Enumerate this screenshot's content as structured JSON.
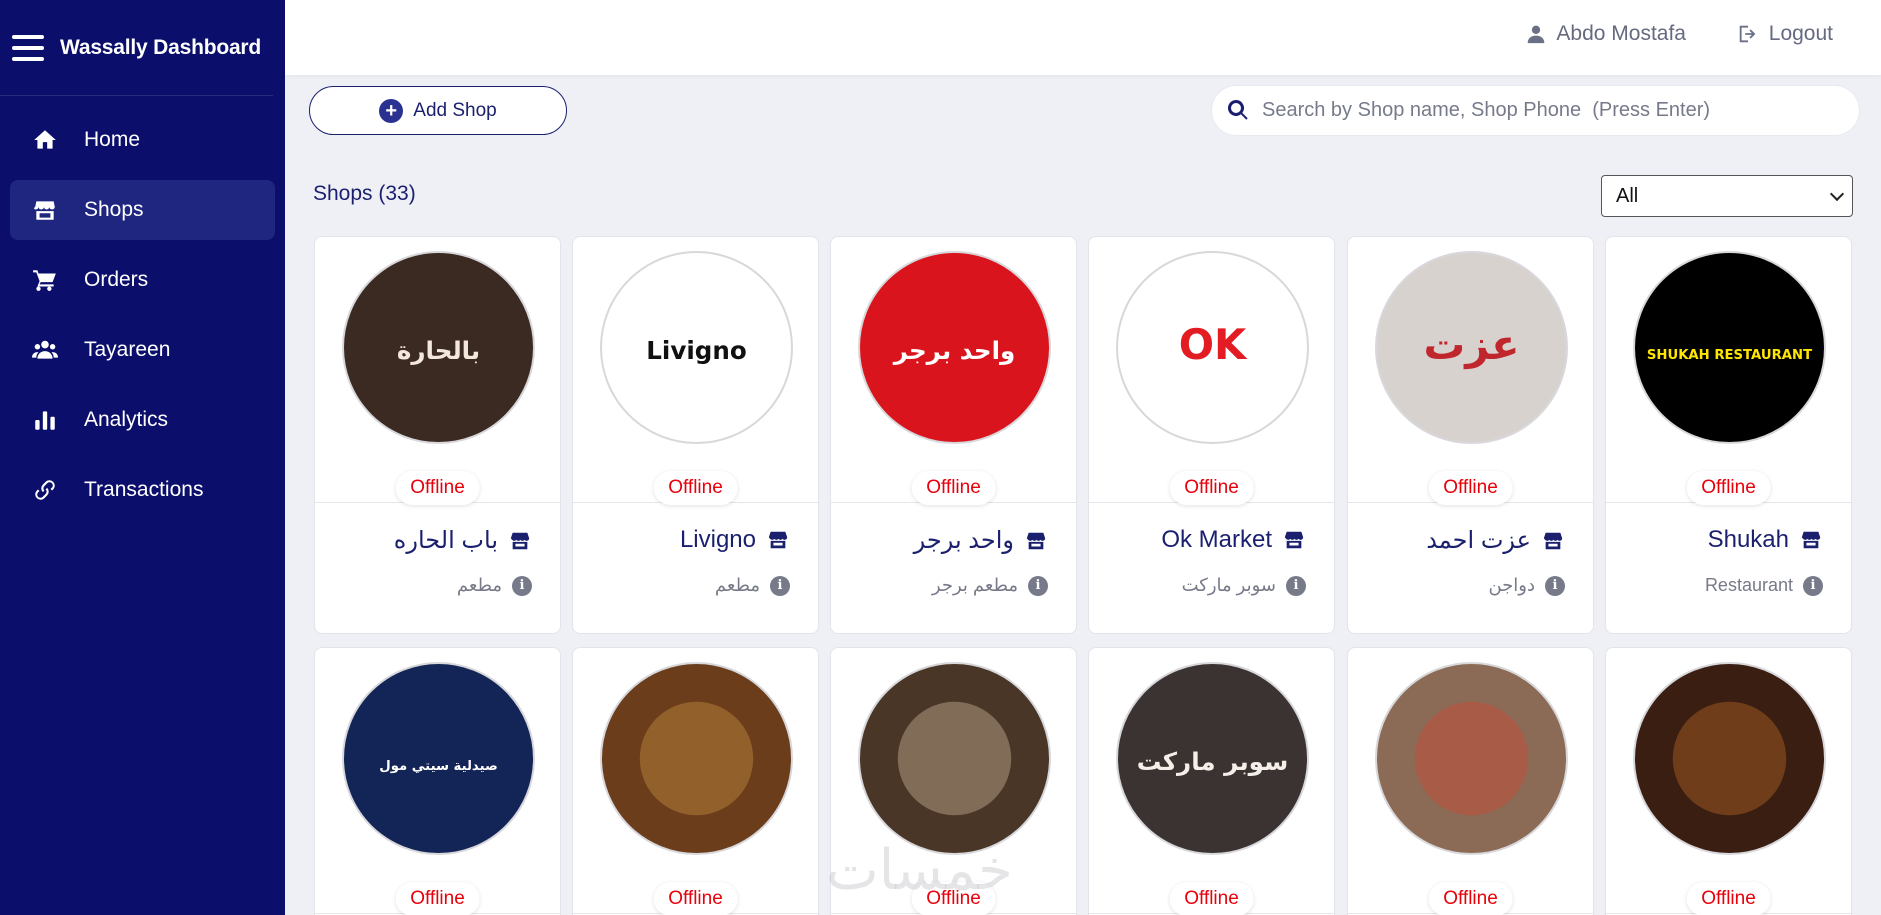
{
  "brand": {
    "title": "Wassally Dashboard"
  },
  "nav": [
    {
      "label": "Home",
      "icon": "home-icon"
    },
    {
      "label": "Shops",
      "icon": "store-icon",
      "active": true
    },
    {
      "label": "Orders",
      "icon": "cart-icon"
    },
    {
      "label": "Tayareen",
      "icon": "users-icon"
    },
    {
      "label": "Analytics",
      "icon": "chart-bar-icon"
    },
    {
      "label": "Transactions",
      "icon": "link-icon"
    }
  ],
  "header": {
    "user_name": "Abdo Mostafa",
    "logout_label": "Logout"
  },
  "toolbar": {
    "add_shop_label": "Add Shop",
    "search_placeholder": "Search by Shop name, Shop Phone  (Press Enter)",
    "shops_count_label": "Shops (33)",
    "filter_value": "All"
  },
  "shops": [
    {
      "name": "باب الحاره",
      "category": "مطعم",
      "status": "Offline",
      "logo_text": "بالحارة",
      "logo_bg": "#3b2a22",
      "logo_fg": "#f2e8dc"
    },
    {
      "name": "Livigno",
      "category": "مطعم",
      "status": "Offline",
      "logo_text": "Livigno",
      "logo_bg": "#ffffff",
      "logo_fg": "#111111"
    },
    {
      "name": "واحد برجر",
      "category": "مطعم برجر",
      "status": "Offline",
      "logo_text": "واحد برجر",
      "logo_bg": "#d9141c",
      "logo_fg": "#ffffff"
    },
    {
      "name": "Ok Market",
      "category": "سوبر ماركت",
      "status": "Offline",
      "logo_text": "OK",
      "logo_bg": "#ffffff",
      "logo_fg": "#e31b23"
    },
    {
      "name": "عزت احمد",
      "category": "دواجن",
      "status": "Offline",
      "logo_text": "عزت",
      "logo_bg": "#d8d2cf",
      "logo_fg": "#c0272d"
    },
    {
      "name": "Shukah",
      "category": "Restaurant",
      "status": "Offline",
      "logo_text": "SHUKAH RESTAURANT",
      "logo_bg": "#000000",
      "logo_fg": "#ffe600"
    },
    {
      "name": "",
      "category": "",
      "status": "Offline",
      "logo_text": "صيدلية سيتي مول",
      "logo_bg": "#132456",
      "logo_fg": "#ffffff"
    },
    {
      "name": "",
      "category": "",
      "status": "Offline",
      "logo_text": "",
      "logo_bg": "#6b3d1b",
      "logo_fg": "#d9a24a"
    },
    {
      "name": "",
      "category": "",
      "status": "Offline",
      "logo_text": "",
      "logo_bg": "#4a3627",
      "logo_fg": "#e7d2b2"
    },
    {
      "name": "",
      "category": "",
      "status": "Offline",
      "logo_text": "سوبر ماركت",
      "logo_bg": "#3a3332",
      "logo_fg": "#f4efe8"
    },
    {
      "name": "",
      "category": "",
      "status": "Offline",
      "logo_text": "",
      "logo_bg": "#8b6b55",
      "logo_fg": "#e0402d"
    },
    {
      "name": "",
      "category": "",
      "status": "Offline",
      "logo_text": "",
      "logo_bg": "#3a1e12",
      "logo_fg": "#d8782f"
    }
  ],
  "watermark": "خمسات",
  "colors": {
    "sidebar": "#0b0f6b",
    "primary": "#1a1f6e",
    "offline": "#e8000b"
  }
}
